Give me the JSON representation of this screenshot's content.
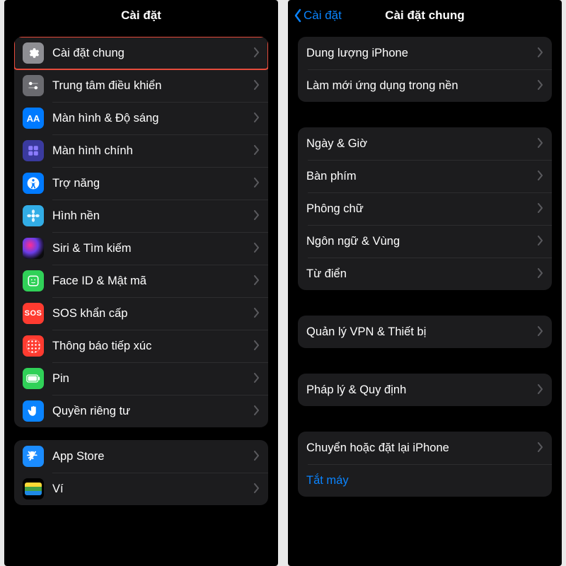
{
  "left": {
    "title": "Cài đặt",
    "group1": [
      {
        "id": "general",
        "label": "Cài đặt chung",
        "iconClass": "bg-gray",
        "svg": "gear",
        "highlight": true
      },
      {
        "id": "control",
        "label": "Trung tâm điều khiển",
        "iconClass": "bg-gray2",
        "svg": "sliders"
      },
      {
        "id": "display",
        "label": "Màn hình & Độ sáng",
        "iconClass": "bg-blue",
        "svg": "AA"
      },
      {
        "id": "home",
        "label": "Màn hình chính",
        "iconClass": "bg-indigo",
        "svg": "grid"
      },
      {
        "id": "access",
        "label": "Trợ năng",
        "iconClass": "bg-blue",
        "svg": "access"
      },
      {
        "id": "wallpaper",
        "label": "Hình nền",
        "iconClass": "bg-cyan",
        "svg": "flower"
      },
      {
        "id": "siri",
        "label": "Siri & Tìm kiếm",
        "iconClass": "siri-orb",
        "svg": ""
      },
      {
        "id": "faceid",
        "label": "Face ID & Mật mã",
        "iconClass": "bg-green",
        "svg": "face"
      },
      {
        "id": "sos",
        "label": "SOS khẩn cấp",
        "iconClass": "bg-red",
        "svg": "SOS"
      },
      {
        "id": "exposure",
        "label": "Thông báo tiếp xúc",
        "iconClass": "bg-red",
        "svg": "exposure"
      },
      {
        "id": "battery",
        "label": "Pin",
        "iconClass": "bg-green",
        "svg": "battery"
      },
      {
        "id": "privacy",
        "label": "Quyền riêng tư",
        "iconClass": "bg-bluehand",
        "svg": "hand"
      }
    ],
    "group2": [
      {
        "id": "appstore",
        "label": "App Store",
        "iconClass": "bg-appstore",
        "svg": "appstore"
      },
      {
        "id": "wallet",
        "label": "Ví",
        "iconClass": "bg-wallet",
        "svg": "wallet"
      }
    ]
  },
  "right": {
    "back": "Cài đặt",
    "title": "Cài đặt chung",
    "group0": [
      {
        "label": "Dung lượng iPhone"
      },
      {
        "label": "Làm mới ứng dụng trong nền"
      }
    ],
    "group1": [
      {
        "label": "Ngày & Giờ"
      },
      {
        "label": "Bàn phím"
      },
      {
        "label": "Phông chữ"
      },
      {
        "label": "Ngôn ngữ & Vùng"
      },
      {
        "label": "Từ điển"
      }
    ],
    "group2": [
      {
        "label": "Quản lý VPN & Thiết bị",
        "highlight": true
      }
    ],
    "group3": [
      {
        "label": "Pháp lý & Quy định"
      }
    ],
    "group4": [
      {
        "label": "Chuyển hoặc đặt lại iPhone",
        "chevron": true
      },
      {
        "label": "Tắt máy",
        "chevron": false,
        "link": true
      }
    ]
  }
}
